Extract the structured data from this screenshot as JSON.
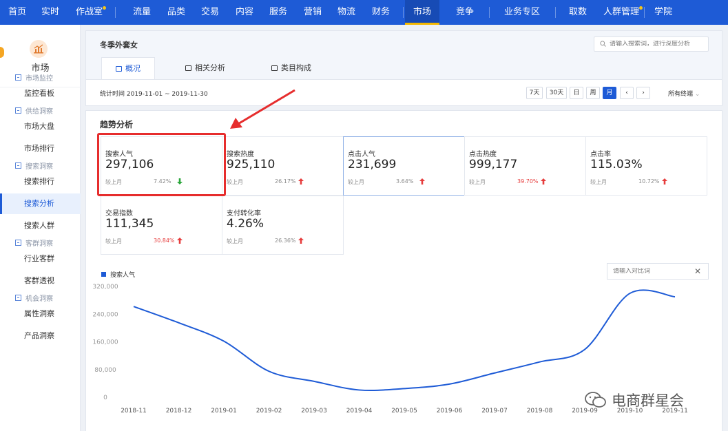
{
  "nav": {
    "items": [
      {
        "label": "首页",
        "dot": false,
        "active": false
      },
      {
        "label": "实时",
        "dot": false,
        "active": false
      },
      {
        "label": "作战室",
        "dot": true,
        "active": false
      },
      {
        "label": "流量",
        "dot": false,
        "active": false
      },
      {
        "label": "品类",
        "dot": false,
        "active": false
      },
      {
        "label": "交易",
        "dot": false,
        "active": false
      },
      {
        "label": "内容",
        "dot": false,
        "active": false
      },
      {
        "label": "服务",
        "dot": false,
        "active": false
      },
      {
        "label": "营销",
        "dot": false,
        "active": false
      },
      {
        "label": "物流",
        "dot": false,
        "active": false
      },
      {
        "label": "财务",
        "dot": false,
        "active": false
      },
      {
        "label": "市场",
        "dot": false,
        "active": true
      },
      {
        "label": "竞争",
        "dot": false,
        "active": false
      },
      {
        "label": "业务专区",
        "dot": false,
        "active": false
      },
      {
        "label": "取数",
        "dot": false,
        "active": false
      },
      {
        "label": "人群管理",
        "dot": true,
        "active": false
      },
      {
        "label": "学院",
        "dot": false,
        "active": false
      }
    ],
    "active_color": "#174bb5",
    "bar_color": "#1e5bd6"
  },
  "sidebar": {
    "title": "市场",
    "icon": "market-chart-icon",
    "groups": [
      {
        "label": "市场监控",
        "items": [
          {
            "label": "监控看板",
            "active": false
          }
        ]
      },
      {
        "label": "供给洞察",
        "items": [
          {
            "label": "市场大盘",
            "active": false
          },
          {
            "label": "市场排行",
            "active": false
          }
        ]
      },
      {
        "label": "搜索洞察",
        "items": [
          {
            "label": "搜索排行",
            "active": false
          },
          {
            "label": "搜索分析",
            "active": true
          },
          {
            "label": "搜索人群",
            "active": false
          }
        ]
      },
      {
        "label": "客群洞察",
        "items": [
          {
            "label": "行业客群",
            "active": false
          },
          {
            "label": "客群透视",
            "active": false
          }
        ]
      },
      {
        "label": "机会洞察",
        "items": [
          {
            "label": "属性洞察",
            "active": false
          },
          {
            "label": "产品洞察",
            "active": false
          }
        ]
      }
    ]
  },
  "header": {
    "keyword": "冬季外套女",
    "search_placeholder": "请输入搜索词，进行深度分析",
    "tabs": [
      {
        "label": "概况",
        "active": true
      },
      {
        "label": "相关分析",
        "active": false
      },
      {
        "label": "类目构成",
        "active": false
      }
    ],
    "period": "统计时间 2019-11-01 ~ 2019-11-30",
    "period_buttons": [
      {
        "label": "7天",
        "active": false
      },
      {
        "label": "30天",
        "active": false
      },
      {
        "label": "日",
        "active": false
      },
      {
        "label": "周",
        "active": false
      },
      {
        "label": "月",
        "active": true
      },
      {
        "label": "‹",
        "active": false
      },
      {
        "label": "›",
        "active": false
      }
    ],
    "terminal": "所有终端"
  },
  "trend": {
    "title": "趋势分析",
    "metrics": [
      {
        "label": "搜索人气",
        "value": "297,106",
        "compare": "较上月",
        "change": "7.42%",
        "direction": "down",
        "highlight": false
      },
      {
        "label": "搜索热度",
        "value": "925,110",
        "compare": "较上月",
        "change": "26.17%",
        "direction": "up",
        "highlight": false
      },
      {
        "label": "点击人气",
        "value": "231,699",
        "compare": "较上月",
        "change": "3.64%",
        "direction": "up",
        "highlight": false
      },
      {
        "label": "点击热度",
        "value": "999,177",
        "compare": "较上月",
        "change": "39.70%",
        "direction": "up",
        "highlight": true
      },
      {
        "label": "点击率",
        "value": "115.03%",
        "compare": "较上月",
        "change": "10.72%",
        "direction": "up",
        "highlight": false
      },
      {
        "label": "交易指数",
        "value": "111,345",
        "compare": "较上月",
        "change": "30.84%",
        "direction": "up",
        "highlight": true
      },
      {
        "label": "支付转化率",
        "value": "4.26%",
        "compare": "较上月",
        "change": "26.36%",
        "direction": "up",
        "highlight": false
      }
    ],
    "legend": "搜索人气",
    "compare_placeholder": "请输入对比词",
    "compare_close": "✕"
  },
  "chart_data": {
    "type": "line",
    "x": [
      "2018-11",
      "2018-12",
      "2019-01",
      "2019-02",
      "2019-03",
      "2019-04",
      "2019-05",
      "2019-06",
      "2019-07",
      "2019-08",
      "2019-09",
      "2019-10",
      "2019-11"
    ],
    "series": [
      {
        "name": "搜索人气",
        "color": "#1e5bd6",
        "values": [
          262000,
          215000,
          162000,
          75000,
          46000,
          21000,
          25000,
          38000,
          70000,
          102000,
          138000,
          300000,
          290000
        ]
      }
    ],
    "yticks": [
      "320,000",
      "240,000",
      "160,000",
      "80,000",
      "0"
    ],
    "ylim": [
      0,
      320000
    ],
    "grid": false
  },
  "watermark": "电商群星会"
}
